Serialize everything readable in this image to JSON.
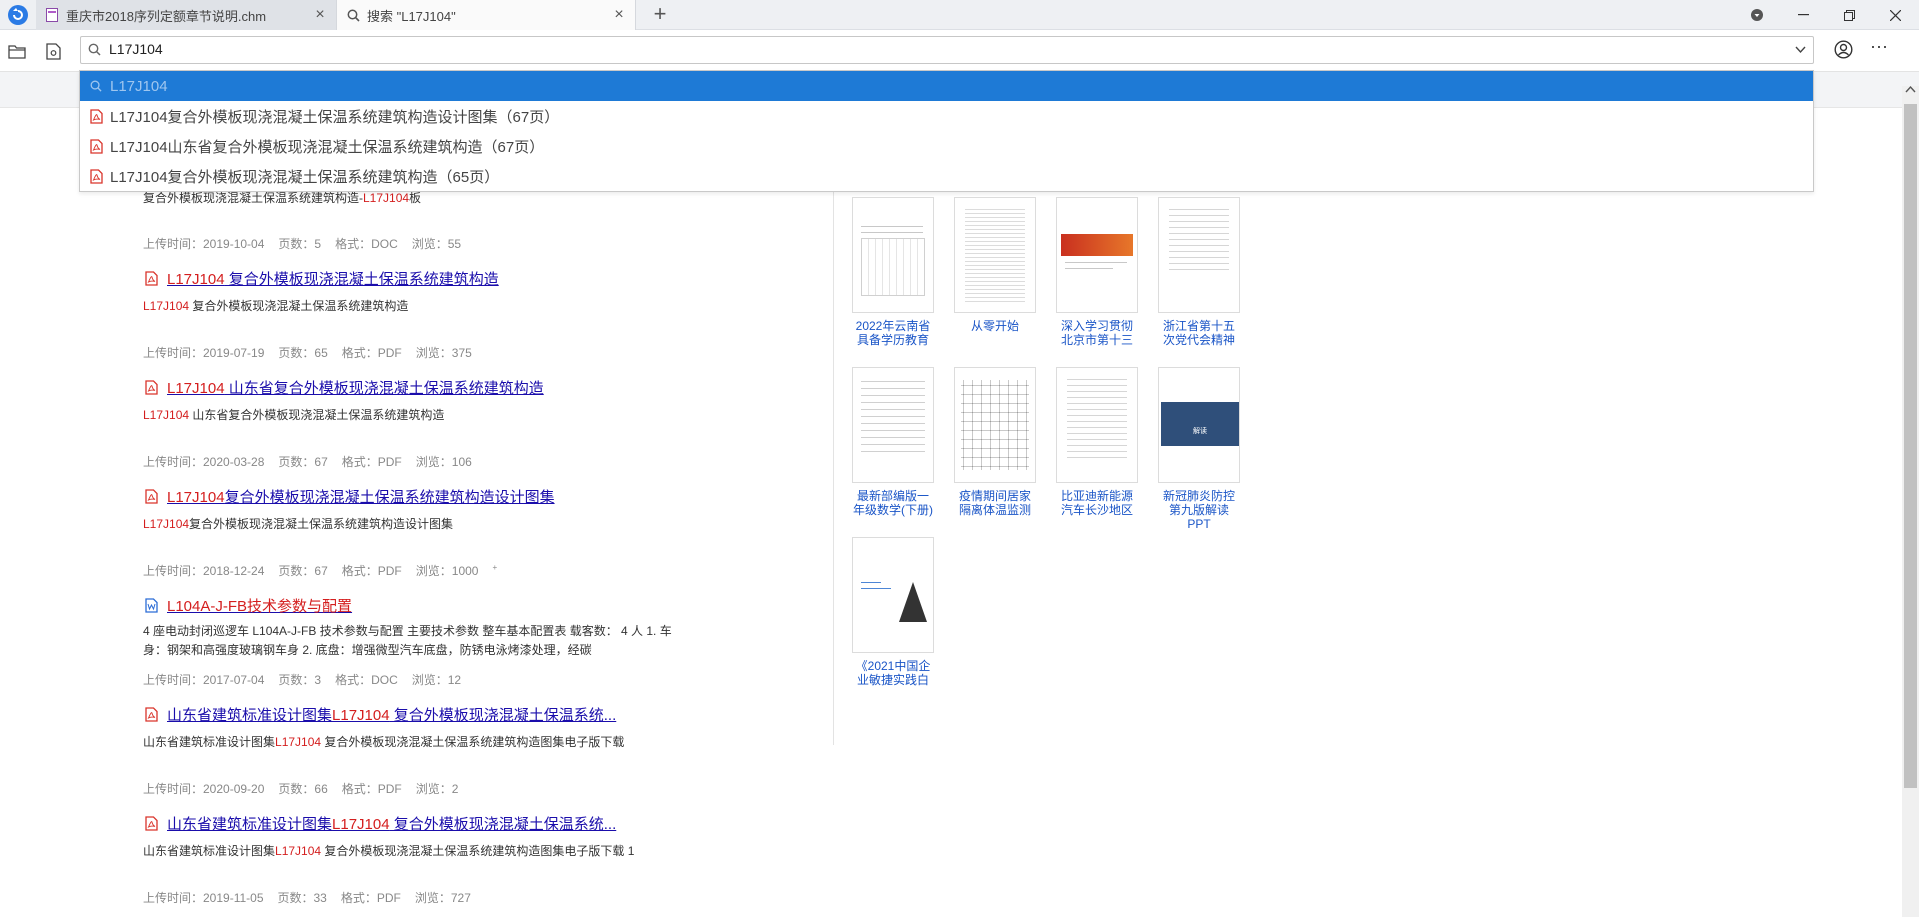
{
  "tabs": [
    {
      "label": "重庆市2018序列定额章节说明.chm"
    },
    {
      "label": "搜索 \"L17J104\""
    }
  ],
  "address": {
    "value": "L17J104"
  },
  "suggestions": [
    {
      "text": "L17J104"
    },
    {
      "text": "L17J104复合外模板现浇混凝土保温系统建筑构造设计图集（67页）"
    },
    {
      "text": "L17J104山东省复合外模板现浇混凝土保温系统建筑构造（67页）"
    },
    {
      "text": "L17J104复合外模板现浇混凝土保温系统建筑构造（65页）"
    }
  ],
  "results": {
    "partial": {
      "pre": "复合外模板现浇混凝土保温系统建筑构造-",
      "hl": "L17J104",
      "post": "板"
    },
    "items": [
      {
        "meta": {
          "upload": "上传时间：2019-10-04",
          "pages": "页数：5",
          "format": "格式：DOC",
          "views": "浏览：55"
        }
      },
      {
        "title_hl": "L17J104",
        "title_rest": " 复合外模板现浇混凝土保温系统建筑构造",
        "snip_hl": "L17J104",
        "snip_rest": " 复合外模板现浇混凝土保温系统建筑构造",
        "meta": {
          "upload": "上传时间：2019-07-19",
          "pages": "页数：65",
          "format": "格式：PDF",
          "views": "浏览：375"
        }
      },
      {
        "title_hl": "L17J104",
        "title_rest": " 山东省复合外模板现浇混凝土保温系统建筑构造",
        "snip_hl": "L17J104",
        "snip_rest": " 山东省复合外模板现浇混凝土保温系统建筑构造",
        "meta": {
          "upload": "上传时间：2020-03-28",
          "pages": "页数：67",
          "format": "格式：PDF",
          "views": "浏览：106"
        }
      },
      {
        "title_hl": "L17J104",
        "title_rest": "复合外模板现浇混凝土保温系统建筑构造设计图集",
        "snip_hl": "L17J104",
        "snip_rest": "复合外模板现浇混凝土保温系统建筑构造设计图集",
        "meta": {
          "upload": "上传时间：2018-12-24",
          "pages": "页数：67",
          "format": "格式：PDF",
          "views": "浏览：1000",
          "views_sup": "+"
        }
      },
      {
        "title_hl": "L104A-J-FB技术参数与配置",
        "title_rest": "",
        "desc": "4 座电动封闭巡逻车 L104A-J-FB 技术参数与配置 主要技术参数 整车基本配置表 载客数： 4 人 1. 车身：钢架和高强度玻璃钢车身 2. 底盘：增强微型汽车底盘，防锈电泳烤漆处理，经碳",
        "meta": {
          "upload": "上传时间：2017-07-04",
          "pages": "页数：3",
          "format": "格式：DOC",
          "views": "浏览：12"
        }
      },
      {
        "title_pre": "山东省建筑标准设计图集",
        "title_hl": "L17J104",
        "title_rest": " 复合外模板现浇混凝土保温系统...",
        "snip_pre": "山东省建筑标准设计图集",
        "snip_hl": "L17J104",
        "snip_rest": " 复合外模板现浇混凝土保温系统建筑构造图集电子版下载",
        "meta": {
          "upload": "上传时间：2020-09-20",
          "pages": "页数：66",
          "format": "格式：PDF",
          "views": "浏览：2"
        }
      },
      {
        "title_pre": "山东省建筑标准设计图集",
        "title_hl": "L17J104",
        "title_rest": " 复合外模板现浇混凝土保温系统...",
        "snip_pre": "山东省建筑标准设计图集",
        "snip_hl": "L17J104",
        "snip_rest": " 复合外模板现浇混凝土保温系统建筑构造图集电子版下载 1",
        "meta": {
          "upload": "上传时间：2019-11-05",
          "pages": "页数：33",
          "format": "格式：PDF",
          "views": "浏览：727"
        }
      }
    ]
  },
  "recommendations": [
    {
      "line1": "2022年云南省",
      "line2": "具备学历教育"
    },
    {
      "line1": "从零开始",
      "line2": ""
    },
    {
      "line1": "深入学习贯彻",
      "line2": "北京市第十三"
    },
    {
      "line1": "浙江省第十五",
      "line2": "次党代会精神"
    },
    {
      "line1": "最新部编版一",
      "line2": "年级数学(下册)"
    },
    {
      "line1": "疫情期间居家",
      "line2": "隔离体温监测"
    },
    {
      "line1": "比亚迪新能源",
      "line2": "汽车长沙地区"
    },
    {
      "line1": "新冠肺炎防控",
      "line2": "第九版解读PPT"
    },
    {
      "line1": "《2021中国企",
      "line2": "业敏捷实践白"
    }
  ],
  "thumb_texts": {
    "covid_ppt": "解读"
  },
  "colors": {
    "accent": "#1e7ad6",
    "highlight": "#d41e1e",
    "link": "#1a0dab",
    "pdf_icon": "#d9342b",
    "doc_icon": "#2b6cd6"
  },
  "icons": [
    "app-logo-icon",
    "chm-file-icon",
    "search-icon",
    "close-icon",
    "plus-icon",
    "folder-icon",
    "file-icon",
    "account-icon",
    "more-icon",
    "pdf-icon",
    "word-icon",
    "chevron-down-icon",
    "scroll-up-icon"
  ]
}
